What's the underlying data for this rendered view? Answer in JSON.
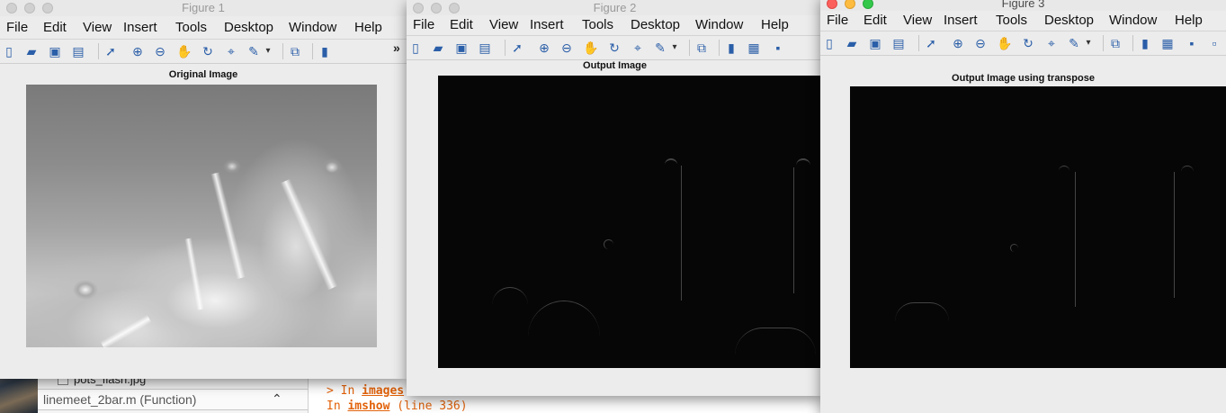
{
  "desktop": {
    "file_name": "pots_flash.jpg",
    "function_label": "linemeet_2bar.m  (Function)",
    "function_chevron": "⌃",
    "cmd_lines": [
      {
        "prefix": "> In ",
        "fn": "images",
        "suffix": ""
      },
      {
        "prefix": "  In ",
        "fn": "imshow",
        "suffix": " (line 336)"
      }
    ]
  },
  "menu_labels": [
    "File",
    "Edit",
    "View",
    "Insert",
    "Tools",
    "Desktop",
    "Window",
    "Help"
  ],
  "toolbar_icons": [
    "new-file-icon",
    "open-folder-icon",
    "save-icon",
    "print-icon",
    "pointer-arrow-icon",
    "zoom-in-icon",
    "zoom-out-icon",
    "pan-hand-icon",
    "rotate-3d-icon",
    "data-cursor-icon",
    "brush-icon",
    "brush-dropdown-icon",
    "link-plot-icon",
    "colorbar-icon",
    "legend-icon",
    "hide-plot-tools-icon",
    "show-plot-tools-icon"
  ],
  "figures": [
    {
      "title": "Figure 1",
      "axes_title": "Original Image",
      "overflow": "»"
    },
    {
      "title": "Figure 2",
      "axes_title": "Output Image"
    },
    {
      "title": "Figure 3",
      "axes_title": "Output Image using transpose"
    }
  ],
  "colors": {
    "window_bg": "#ececec",
    "cmd_orange": "#e2620a",
    "icon_blue": "#2a5ea8"
  }
}
